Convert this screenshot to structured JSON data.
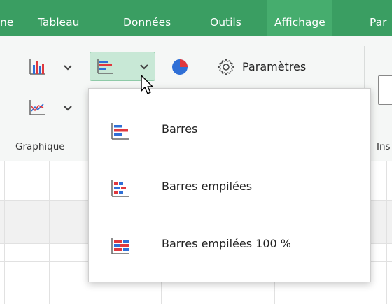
{
  "menubar": {
    "items": [
      {
        "label": "ne"
      },
      {
        "label": "Tableau"
      },
      {
        "label": "Données"
      },
      {
        "label": "Outils"
      },
      {
        "label": "Affichage"
      },
      {
        "label": "Par"
      }
    ]
  },
  "ribbon": {
    "settings_label": "Paramètres",
    "group_chart_label": "Graphique",
    "group_insert_label": "Ins"
  },
  "dropdown": {
    "items": [
      {
        "label": "Barres",
        "icon": "bar-chart-icon"
      },
      {
        "label": "Barres empilées",
        "icon": "stacked-bar-chart-icon"
      },
      {
        "label": "Barres empilées 100 %",
        "icon": "stacked-bar-100-chart-icon"
      }
    ]
  },
  "colors": {
    "menubar": "#3a9e62",
    "accent_blue": "#2f6fd6",
    "accent_red": "#e0383e",
    "selected_bg": "#c8e8d6"
  }
}
